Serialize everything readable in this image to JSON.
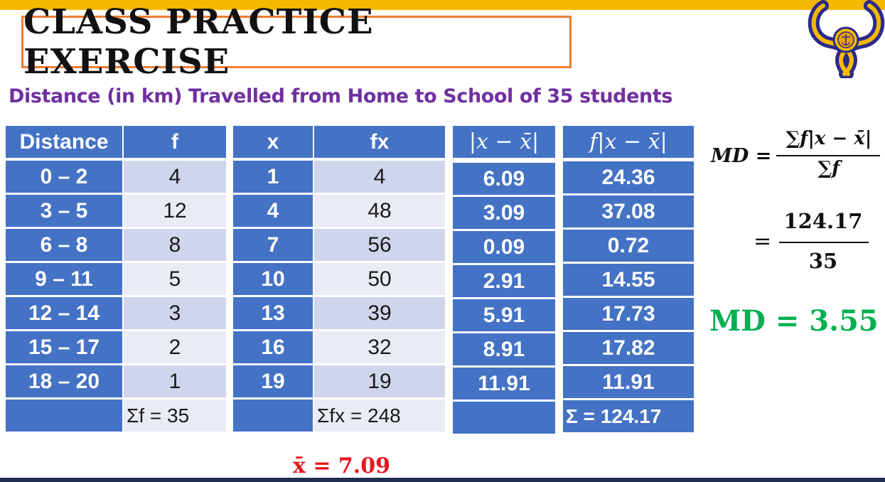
{
  "title": "CLASS PRACTICE EXERCISE",
  "subtitle": "Distance (in km) Travelled from Home to School of 35 students",
  "colors": {
    "top_band": "#f5b800",
    "table_header": "#4472c4",
    "title_border": "#ed7d31",
    "subtitle": "#7030a0",
    "md_result": "#00b050",
    "mean_result": "#e8151b"
  },
  "table1": {
    "headers": [
      "Distance",
      "f"
    ],
    "rows": [
      [
        "0 – 2",
        "4"
      ],
      [
        "3 – 5",
        "12"
      ],
      [
        "6 – 8",
        "8"
      ],
      [
        "9 – 11",
        "5"
      ],
      [
        "12 – 14",
        "3"
      ],
      [
        "15 – 17",
        "2"
      ],
      [
        "18 – 20",
        "1"
      ]
    ],
    "total": "Σf = 35"
  },
  "table2": {
    "headers": [
      "x",
      "fx"
    ],
    "rows": [
      [
        "1",
        "4"
      ],
      [
        "4",
        "48"
      ],
      [
        "7",
        "56"
      ],
      [
        "10",
        "50"
      ],
      [
        "13",
        "39"
      ],
      [
        "16",
        "32"
      ],
      [
        "19",
        "19"
      ]
    ],
    "total": "Σfx = 248"
  },
  "table3": {
    "header": "|x − x̄|",
    "rows": [
      "6.09",
      "3.09",
      "0.09",
      "2.91",
      "5.91",
      "8.91",
      "11.91"
    ]
  },
  "table4": {
    "header": "f|x − x̄|",
    "rows": [
      "24.36",
      "37.08",
      "0.72",
      "14.55",
      "17.73",
      "17.82",
      "11.91"
    ],
    "total": "Σ = 124.17"
  },
  "formula": {
    "lhs": "MD =",
    "numerator": "∑f|x − x̄|",
    "denominator": "∑f",
    "equals": "=",
    "value_numerator": "124.17",
    "value_denominator": "35"
  },
  "md_result": "MD = 3.55",
  "mean_result": "x̄ = 7.09"
}
